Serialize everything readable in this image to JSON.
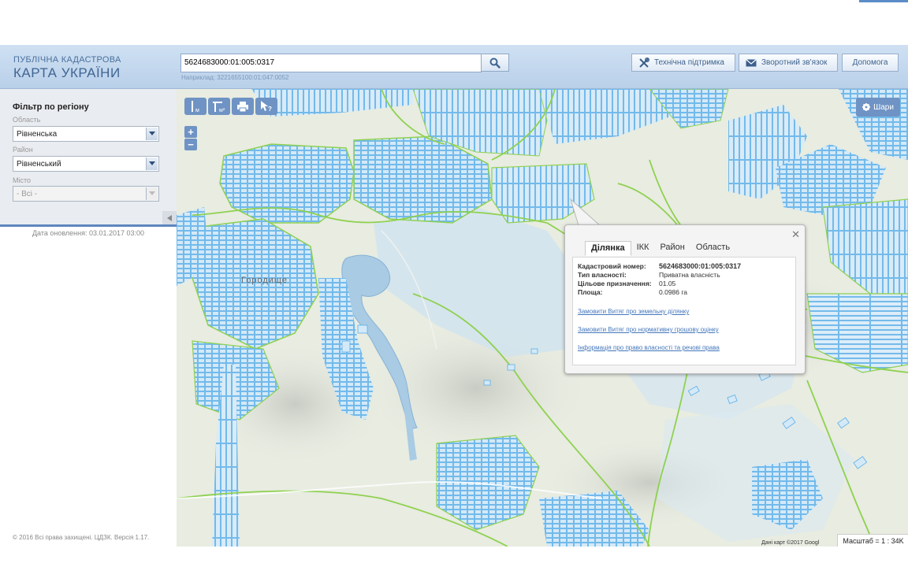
{
  "header": {
    "brand_small": "ПУБЛІЧНА КАДАСТРОВА",
    "brand_big": "КАРТА УКРАЇНИ",
    "search_value": "5624683000:01:005:0317",
    "search_hint": "Наприклад: 3221655100:01:047:0052",
    "buttons": {
      "support": "Технічна підтримка",
      "feedback": "Зворотний зв'язок",
      "help": "Допомога"
    }
  },
  "sidebar": {
    "filter_title": "Фільтр по регіону",
    "region_label": "Область",
    "region_value": "Рівненська",
    "district_label": "Район",
    "district_value": "Рівненський",
    "city_label": "Місто",
    "city_value": "- Всі -",
    "update_date": "Дата оновлення: 03.01.2017 03:00",
    "copyright": "© 2016 Всі права захищені. ЦДЗК. Версія 1.17."
  },
  "map": {
    "layers_button": "Шари",
    "place_label": "Городище",
    "attribution": "Дані карт ©2017 Googl",
    "scale": "Масштаб = 1 : 34K",
    "popup": {
      "tabs": [
        "Ділянка",
        "ІКК",
        "Район",
        "Область"
      ],
      "active_tab": "Ділянка",
      "cadastral_label": "Кадастровий номер:",
      "cadastral_value": "5624683000:01:005:0317",
      "ownership_label": "Тип власності:",
      "ownership_value": "Приватна власність",
      "purpose_label": "Цільове призначення:",
      "purpose_value": "01.05",
      "area_label": "Площа:",
      "area_value": "0.0986 га",
      "links": [
        "Замовити Витяг про земельну ділянку",
        "Замовити Витяг про нормативну грошову оцінку",
        "Інформація про право власності та речові права"
      ]
    }
  },
  "colors": {
    "accent": "#6f93c4",
    "header_bg": "#c6daef",
    "parcel_stroke": "#5aaee8",
    "boundary_green": "#8fd14f",
    "water": "#a9cbe3"
  }
}
